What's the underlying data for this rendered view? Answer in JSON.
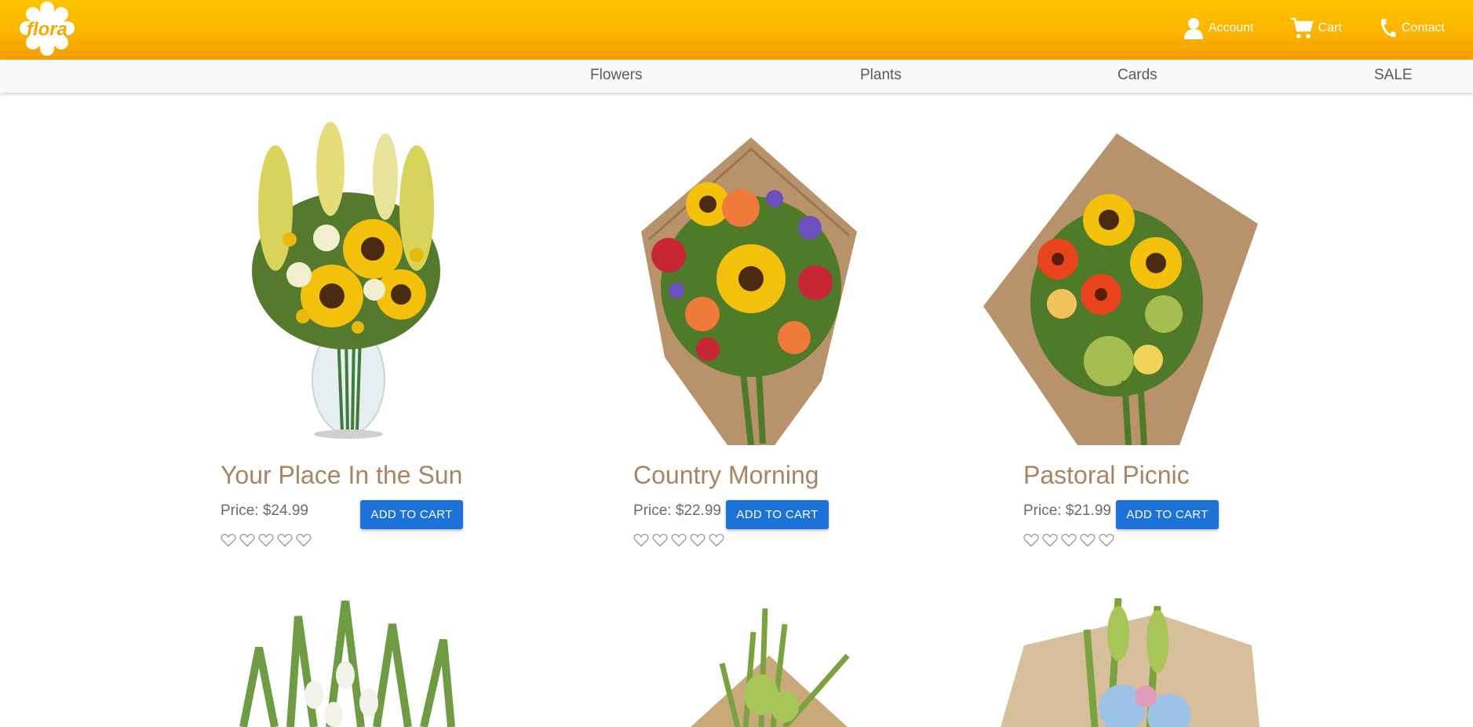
{
  "brand": {
    "logo_text": "flora",
    "header_color": "#fbb300"
  },
  "top_links": [
    {
      "label": "Account",
      "icon": "user-icon"
    },
    {
      "label": "Cart",
      "icon": "cart-icon"
    },
    {
      "label": "Contact",
      "icon": "phone-icon"
    }
  ],
  "nav": [
    {
      "label": "Flowers"
    },
    {
      "label": "Plants"
    },
    {
      "label": "Cards"
    },
    {
      "label": "SALE"
    }
  ],
  "products": [
    {
      "name": "Your Place In the Sun",
      "price": "Price: $24.99",
      "button": "ADD TO CART",
      "rating": 0,
      "max_rating": 5
    },
    {
      "name": "Country Morning",
      "price": "Price: $22.99",
      "button": "ADD TO CART",
      "rating": 0,
      "max_rating": 5
    },
    {
      "name": "Pastoral Picnic",
      "price": "Price: $21.99",
      "button": "ADD TO CART",
      "rating": 0,
      "max_rating": 5
    },
    {
      "name": "",
      "price": "",
      "button": "",
      "rating": 0,
      "max_rating": 5
    },
    {
      "name": "",
      "price": "",
      "button": "",
      "rating": 0,
      "max_rating": 5
    },
    {
      "name": "",
      "price": "",
      "button": "",
      "rating": 0,
      "max_rating": 5
    }
  ],
  "colors": {
    "accent_button": "#1d72d8",
    "title_color": "#a98462"
  }
}
